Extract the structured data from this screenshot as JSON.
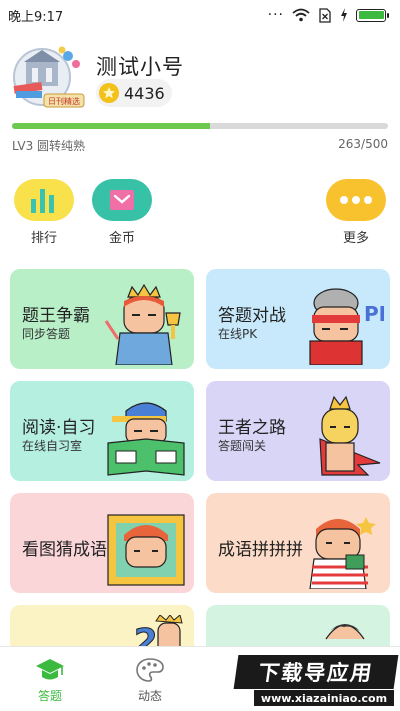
{
  "status_bar": {
    "time": "晚上9:17",
    "dots": "···"
  },
  "profile": {
    "name": "测试小号",
    "coins": "4436",
    "avatar_tag": "日刊精选",
    "level_text": "LV3 圆转纯熟",
    "xp_text": "263/500",
    "xp_progress": 0.526
  },
  "quick_actions": [
    {
      "label": "排行",
      "icon": "bar-chart-icon",
      "color": "#f8e14b"
    },
    {
      "label": "金币",
      "icon": "envelope-icon",
      "color": "#37c2a7"
    },
    {
      "label": "更多",
      "icon": "more-dots-icon",
      "color": "#f8c22e"
    }
  ],
  "cards": [
    {
      "title": "题王争霸",
      "subtitle": "同步答题",
      "color": "#b8efc7"
    },
    {
      "title": "答题对战",
      "subtitle": "在线PK",
      "color": "#c7e9fb"
    },
    {
      "title": "阅读·自习",
      "subtitle": "在线自习室",
      "color": "#b4efe0"
    },
    {
      "title": "王者之路",
      "subtitle": "答题闯关",
      "color": "#d9d5f7"
    },
    {
      "title": "看图猜成语",
      "subtitle": "",
      "color": "#fbd6d9"
    },
    {
      "title": "成语拼拼拼",
      "subtitle": "",
      "color": "#fcdcc9"
    },
    {
      "title": "",
      "subtitle": "",
      "color": "#fbf3c4"
    },
    {
      "title": "",
      "subtitle": "",
      "color": "#d4f3e0"
    }
  ],
  "bottom_nav": [
    {
      "label": "答题",
      "icon": "graduation-cap-icon",
      "active": true
    },
    {
      "label": "动态",
      "icon": "palette-icon",
      "active": false
    },
    {
      "label": "",
      "icon": "",
      "active": false
    },
    {
      "label": "",
      "icon": "",
      "active": false
    }
  ],
  "watermark": {
    "main": "下载导应用",
    "sub": "www.xiazainiao.com"
  },
  "colors": {
    "accent": "#3cb93f",
    "xp_fill": "#6cc94e",
    "coin": "#f3c21a"
  }
}
